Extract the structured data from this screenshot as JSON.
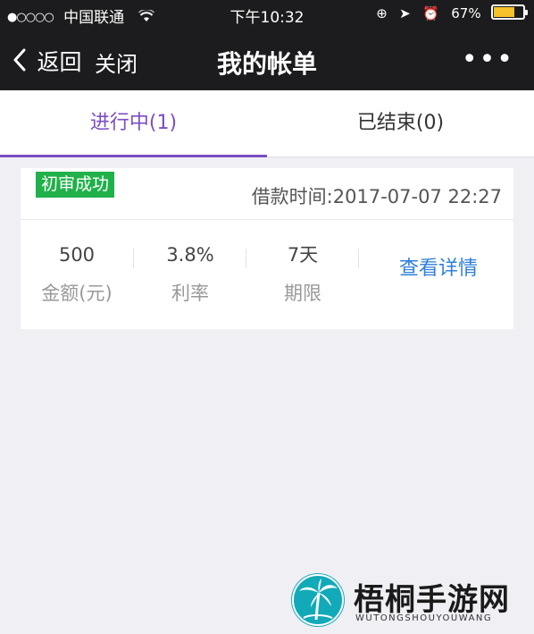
{
  "status_bar": {
    "signal": "●○○○○",
    "carrier": "中国联通",
    "wifi_icon": "wifi-icon",
    "time": "下午10:32",
    "battery_percent": "67%",
    "battery_level": 0.67,
    "battery_color": "#f6c12b"
  },
  "nav": {
    "back_label": "返回",
    "close_label": "关闭",
    "title": "我的帐单",
    "more_label": "•••"
  },
  "tabs": [
    {
      "label": "进行中(1)",
      "active": true
    },
    {
      "label": "已结束(0)",
      "active": false
    }
  ],
  "accent_color": "#7b4ec2",
  "bill": {
    "status_badge": "初审成功",
    "status_color": "#20b14a",
    "loan_time": "借款时间:2017-07-07 22:27",
    "stats": [
      {
        "value": "500",
        "label": "金额(元)"
      },
      {
        "value": "3.8%",
        "label": "利率"
      },
      {
        "value": "7天",
        "label": "期限"
      }
    ],
    "detail_link": "查看详情",
    "link_color": "#2f7fd8"
  },
  "watermark": {
    "title": "梧桐手游网",
    "subtitle": "WUTONGSHOUYOUWANG"
  }
}
